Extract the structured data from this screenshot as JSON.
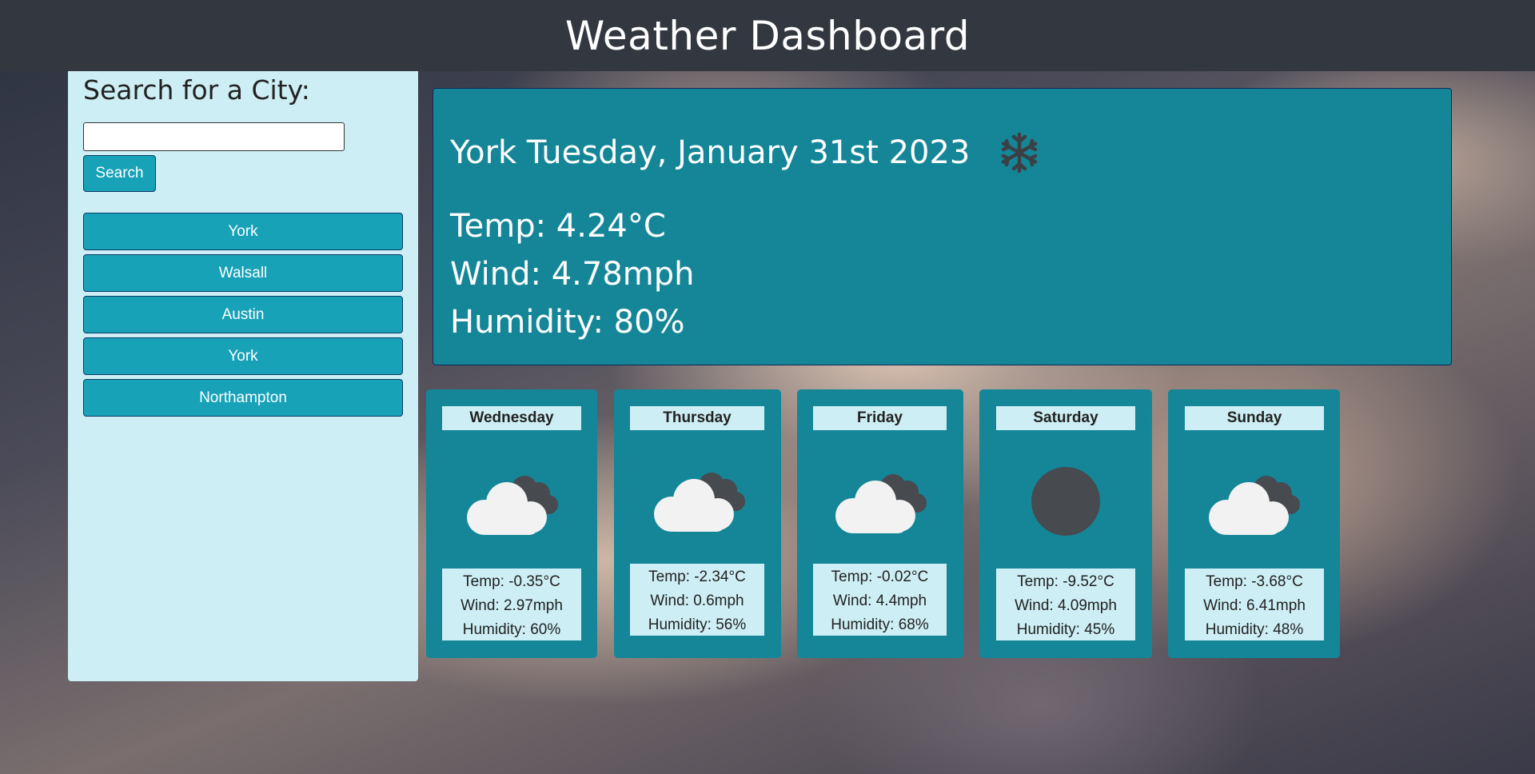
{
  "header": {
    "title": "Weather Dashboard"
  },
  "sidebar": {
    "heading": "Search for a City:",
    "search": {
      "value": "",
      "placeholder": ""
    },
    "search_button": "Search",
    "history": [
      "York",
      "Walsall",
      "Austin",
      "York",
      "Northampton"
    ]
  },
  "current": {
    "city_date": "York Tuesday, January 31st 2023",
    "icon": "snowflake-icon",
    "temp": "Temp: 4.24°C",
    "wind": "Wind: 4.78mph",
    "humidity": "Humidity: 80%"
  },
  "forecast": [
    {
      "day": "Wednesday",
      "icon": "cloudy-icon",
      "temp": "Temp: -0.35°C",
      "wind": "Wind: 2.97mph",
      "humidity": "Humidity: 60%"
    },
    {
      "day": "Thursday",
      "icon": "cloudy-icon",
      "temp": "Temp: -2.34°C",
      "wind": "Wind: 0.6mph",
      "humidity": "Humidity: 56%"
    },
    {
      "day": "Friday",
      "icon": "cloudy-icon",
      "temp": "Temp: -0.02°C",
      "wind": "Wind: 4.4mph",
      "humidity": "Humidity: 68%"
    },
    {
      "day": "Saturday",
      "icon": "clear-night-icon",
      "temp": "Temp: -9.52°C",
      "wind": "Wind: 4.09mph",
      "humidity": "Humidity: 45%"
    },
    {
      "day": "Sunday",
      "icon": "cloudy-icon",
      "temp": "Temp: -3.68°C",
      "wind": "Wind: 6.41mph",
      "humidity": "Humidity: 48%"
    }
  ],
  "colors": {
    "header_bg": "#33373f",
    "sidebar_bg": "#cdeef5",
    "button_bg": "#17a2b8",
    "card_bg": "#148698"
  }
}
